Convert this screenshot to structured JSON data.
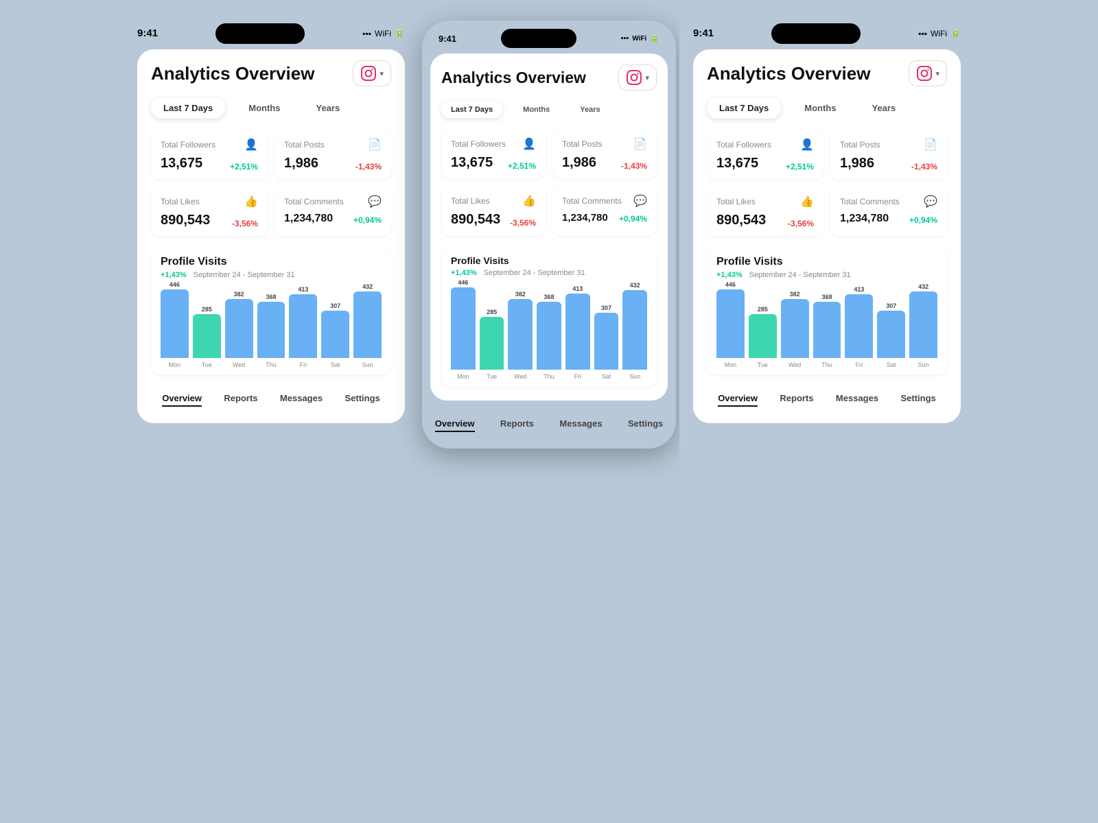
{
  "app": {
    "title": "Analytics Overview",
    "time": "9:41",
    "ig_label": "IG",
    "chevron": "▾"
  },
  "filters": {
    "active": "Last 7 Days",
    "options": [
      "Last 7 Days",
      "Months",
      "Years"
    ]
  },
  "stats": {
    "followers": {
      "label": "Total Followers",
      "value": "13,675",
      "change": "+2,51%",
      "change_type": "positive"
    },
    "posts": {
      "label": "Total Posts",
      "value": "1,986",
      "change": "-1,43%",
      "change_type": "negative"
    },
    "likes": {
      "label": "Total Likes",
      "value": "890,543",
      "change": "-3,56%",
      "change_type": "negative"
    },
    "comments": {
      "label": "Total Comments",
      "value": "1,234,780",
      "change": "+0,94%",
      "change_type": "positive"
    }
  },
  "chart": {
    "title": "Profile Visits",
    "change": "+1,43%",
    "date_range": "September 24 - September 31",
    "bars": [
      {
        "label": "Mon",
        "value": 446,
        "highlight": false
      },
      {
        "label": "Tue",
        "value": 285,
        "highlight": true
      },
      {
        "label": "Wed",
        "value": 382,
        "highlight": false
      },
      {
        "label": "Thu",
        "value": 368,
        "highlight": false
      },
      {
        "label": "Fri",
        "value": 413,
        "highlight": false
      },
      {
        "label": "Sat",
        "value": 307,
        "highlight": false
      },
      {
        "label": "Sun",
        "value": 432,
        "highlight": false
      }
    ],
    "max_value": 446
  },
  "nav": {
    "items": [
      "Overview",
      "Reports",
      "Messages",
      "Settings"
    ],
    "active": "Overview"
  }
}
